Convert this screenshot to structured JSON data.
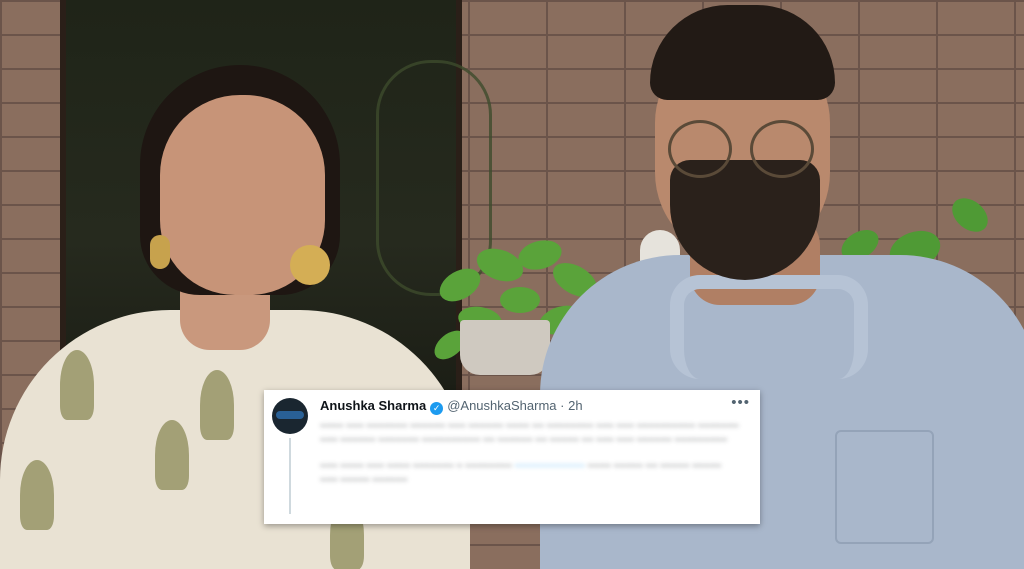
{
  "tweet": {
    "name": "Anushka Sharma",
    "handle": "@AnushkaSharma",
    "separator": "·",
    "time": "2h",
    "more_label": "•••",
    "verified_mark": "✓",
    "avatar_icon": "profile-avatar-icon",
    "colors": {
      "verified": "#1d9bf0",
      "hashtag": "#1d9bf0",
      "name": "#0f1419",
      "meta": "#536471"
    }
  }
}
